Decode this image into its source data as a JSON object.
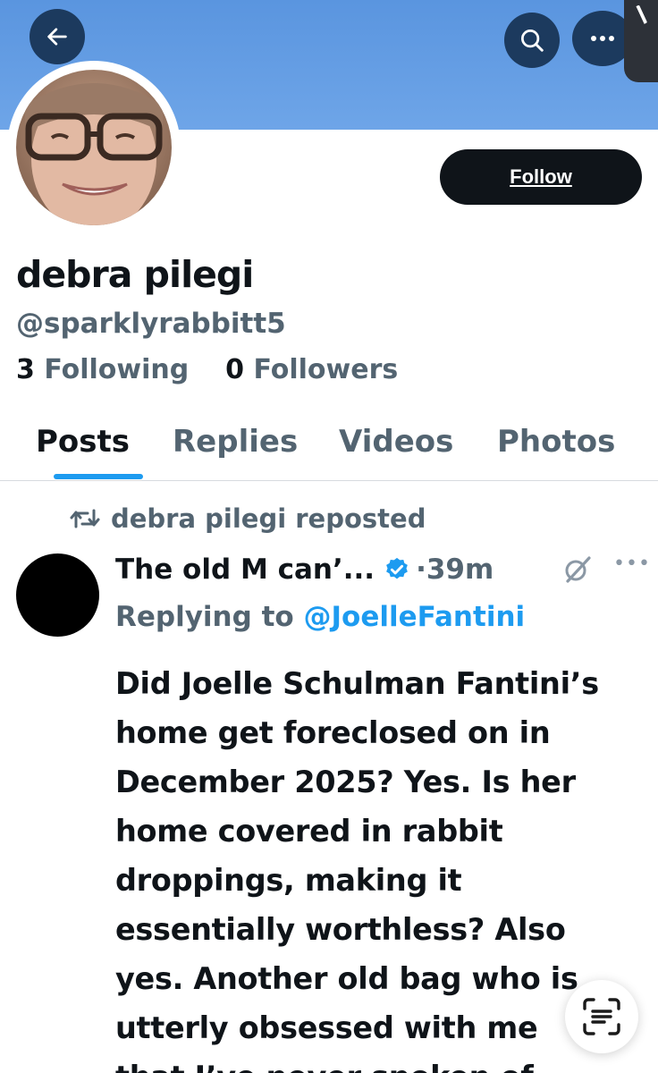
{
  "header": {
    "back_icon": "arrow-left-icon",
    "search_icon": "search-icon",
    "more_icon": "more-horizontal-icon",
    "banner_color": "#6ea5e8"
  },
  "profile": {
    "display_name": "debra pilegi",
    "handle": "@sparklyrabbitt5",
    "follow_label": "Follow",
    "following_count": "3",
    "following_label": "Following",
    "followers_count": "0",
    "followers_label": "Followers"
  },
  "tabs": [
    {
      "label": "Posts",
      "active": true
    },
    {
      "label": "Replies",
      "active": false
    },
    {
      "label": "Videos",
      "active": false
    },
    {
      "label": "Photos",
      "active": false
    }
  ],
  "post": {
    "repost_text": "debra pilegi reposted",
    "author": "The old M can’...",
    "verified": true,
    "time": "39m",
    "replying_prefix": "Replying to",
    "replying_to": "@JoelleFantini",
    "body_lines": [
      "Did Joelle Schulman Fantini’s",
      "home get foreclosed on in",
      "December 2025? Yes. Is her",
      "home covered in rabbit",
      "droppings, making it",
      "essentially worthless? Also",
      "yes. Another old bag who is",
      "utterly obsessed with me",
      "that I’ve never spoken of."
    ]
  },
  "colors": {
    "accent": "#1d9bf0",
    "text_primary": "#0f1419",
    "text_secondary": "#536471"
  }
}
